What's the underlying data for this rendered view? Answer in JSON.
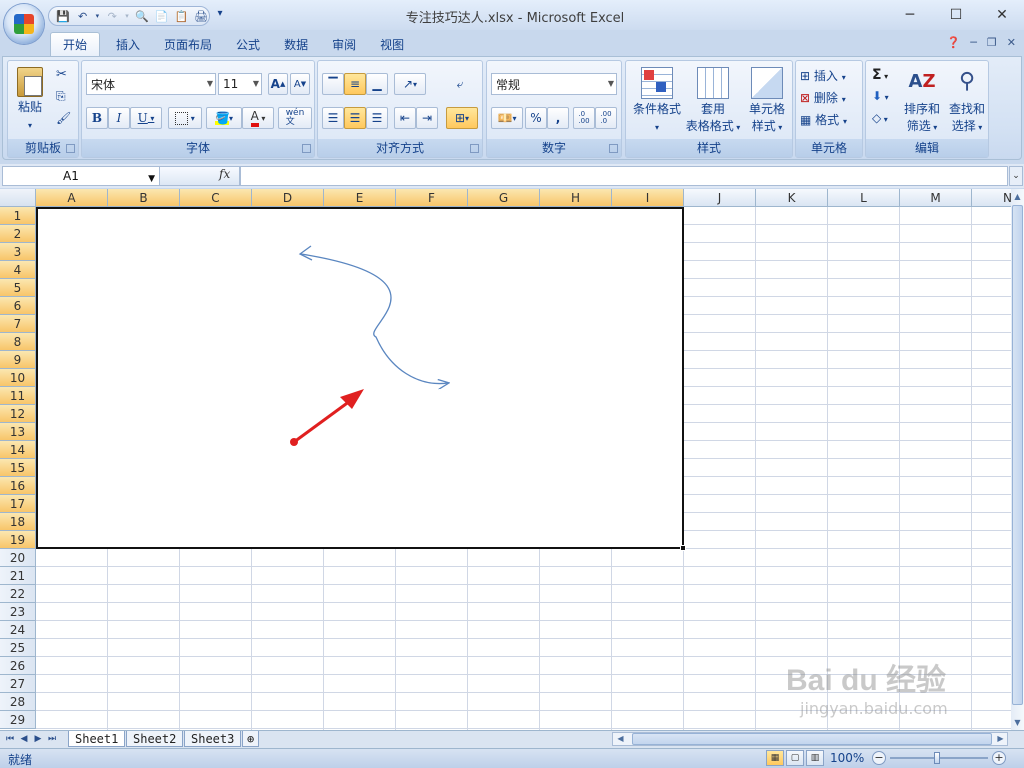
{
  "window": {
    "title": "专注技巧达人.xlsx - Microsoft Excel"
  },
  "ribbon_tabs": [
    "开始",
    "插入",
    "页面布局",
    "公式",
    "数据",
    "审阅",
    "视图"
  ],
  "clipboard": {
    "paste_label": "粘贴",
    "group_label": "剪贴板"
  },
  "font": {
    "name": "宋体",
    "size": "11",
    "group_label": "字体",
    "bold": "B",
    "italic": "I",
    "underline": "U",
    "grow": "A",
    "shrink": "A",
    "color_letter": "A",
    "phonetic": "wén\n文"
  },
  "alignment": {
    "group_label": "对齐方式"
  },
  "number": {
    "format": "常规",
    "group_label": "数字",
    "percent": "%",
    "comma": ",",
    "inc_dec": ".0\n.00",
    "dec_dec": ".00\n.0"
  },
  "styles": {
    "conditional": "条件格式",
    "table_line1": "套用",
    "table_line2": "表格格式",
    "cell_line1": "单元格",
    "cell_line2": "样式",
    "group_label": "样式"
  },
  "cells": {
    "insert": "插入",
    "delete": "删除",
    "format": "格式",
    "group_label": "单元格"
  },
  "editing": {
    "sigma": "Σ",
    "sort_line1": "排序和",
    "sort_line2": "筛选",
    "find_line1": "查找和",
    "find_line2": "选择",
    "group_label": "编辑"
  },
  "formula_bar": {
    "name_box": "A1",
    "fx": "fx",
    "value": ""
  },
  "columns": [
    "A",
    "B",
    "C",
    "D",
    "E",
    "F",
    "G",
    "H",
    "I",
    "J",
    "K",
    "L",
    "M",
    "N"
  ],
  "selected_columns": [
    "A",
    "B",
    "C",
    "D",
    "E",
    "F",
    "G",
    "H",
    "I"
  ],
  "rows": [
    "1",
    "2",
    "3",
    "4",
    "5",
    "6",
    "7",
    "8",
    "9",
    "10",
    "11",
    "12",
    "13",
    "14",
    "15",
    "16",
    "17",
    "18",
    "19",
    "20",
    "21",
    "22",
    "23",
    "24",
    "25",
    "26",
    "27",
    "28",
    "29"
  ],
  "selected_rows_count": 19,
  "sheets": [
    "Sheet1",
    "Sheet2",
    "Sheet3"
  ],
  "active_sheet": "Sheet1",
  "status": {
    "ready": "就绪",
    "zoom": "100%"
  },
  "watermark": {
    "text": "Bai du 经验",
    "sub": "jingyan.baidu.com"
  },
  "colors": {
    "arrow_red": "#e02020",
    "curve_blue": "#5a86c0",
    "header_selected": "#f8c56a"
  }
}
